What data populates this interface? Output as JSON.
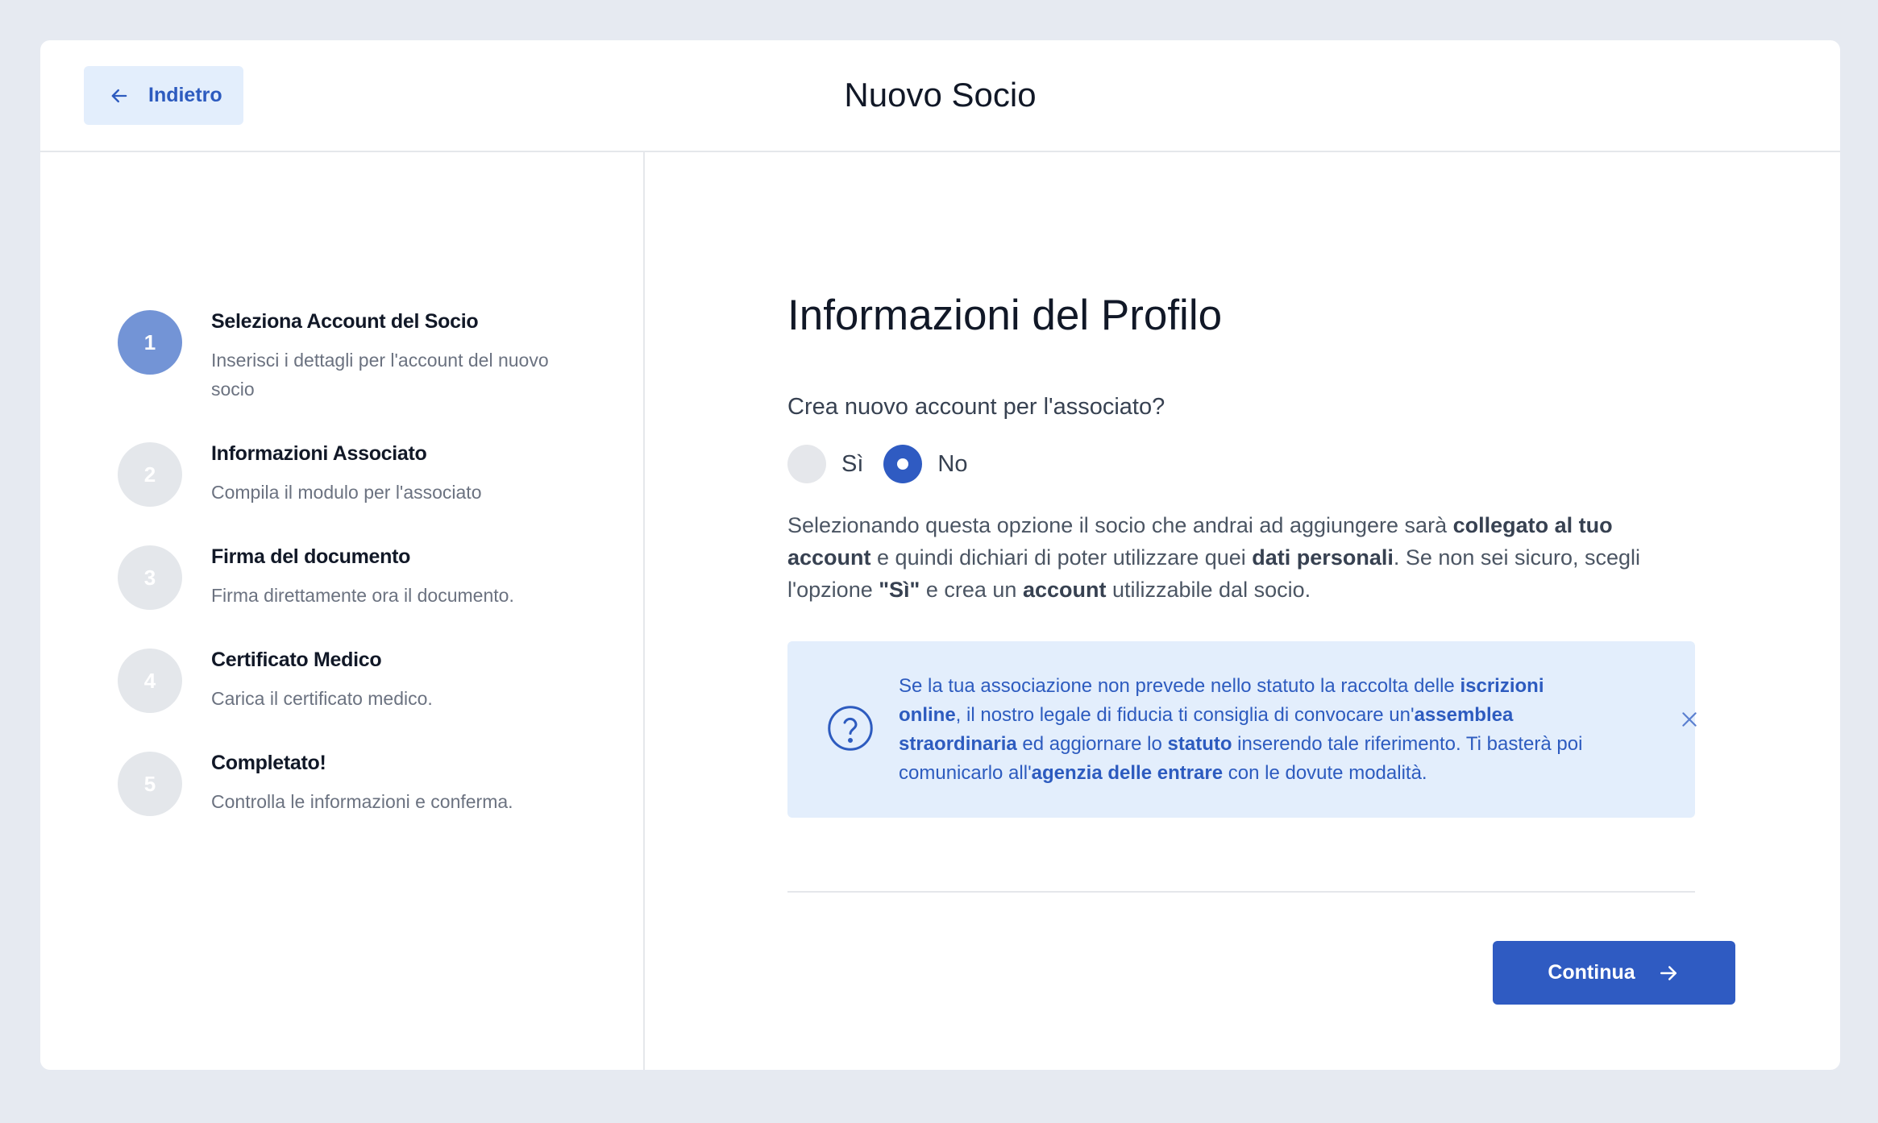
{
  "header": {
    "back_label": "Indietro",
    "title": "Nuovo Socio"
  },
  "steps": [
    {
      "number": "1",
      "title": "Seleziona Account del Socio",
      "desc": "Inserisci i dettagli per l'account del nuovo socio",
      "active": true
    },
    {
      "number": "2",
      "title": "Informazioni Associato",
      "desc": "Compila il modulo per l'associato",
      "active": false
    },
    {
      "number": "3",
      "title": "Firma del documento",
      "desc": "Firma direttamente ora il documento.",
      "active": false
    },
    {
      "number": "4",
      "title": "Certificato Medico",
      "desc": "Carica il certificato medico.",
      "active": false
    },
    {
      "number": "5",
      "title": "Completato!",
      "desc": "Controlla le informazioni e conferma.",
      "active": false
    }
  ],
  "main": {
    "title": "Informazioni del Profilo",
    "question": "Crea nuovo account per l'associato?",
    "options": {
      "si": "Sì",
      "no": "No"
    },
    "selected": "No",
    "explain": {
      "p1": "Selezionando questa opzione il socio che andrai ad aggiungere sarà ",
      "b1": "collegato al tuo account",
      "p2": " e quindi dichiari di poter utilizzare quei ",
      "b2": "dati personali",
      "p3": ". Se non sei sicuro, scegli l'opzione ",
      "b3": "\"Sì\"",
      "p4": " e crea un ",
      "b4": "account",
      "p5": " utilizzabile dal socio."
    },
    "info": {
      "p1": "Se la tua associazione non prevede nello statuto la raccolta delle ",
      "b1": "iscrizioni online",
      "p2": ", il nostro legale di fiducia ti consiglia di convocare un'",
      "b2": "assemblea straordinaria",
      "p3": " ed aggiornare lo ",
      "b3": "statuto",
      "p4": " inserendo tale riferimento. Ti basterà poi comunicarlo all'",
      "b4": "agenzia delle entrare",
      "p5": " con le dovute modalità."
    },
    "continue_label": "Continua"
  },
  "colors": {
    "accent": "#2f5bc2",
    "active_step": "#7394d6",
    "info_bg": "#e3eefc",
    "page_bg": "#e6eaf1"
  },
  "icons": {
    "back": "arrow-left-icon",
    "help": "question-circle-icon",
    "close": "close-icon",
    "continue": "arrow-right-icon"
  }
}
